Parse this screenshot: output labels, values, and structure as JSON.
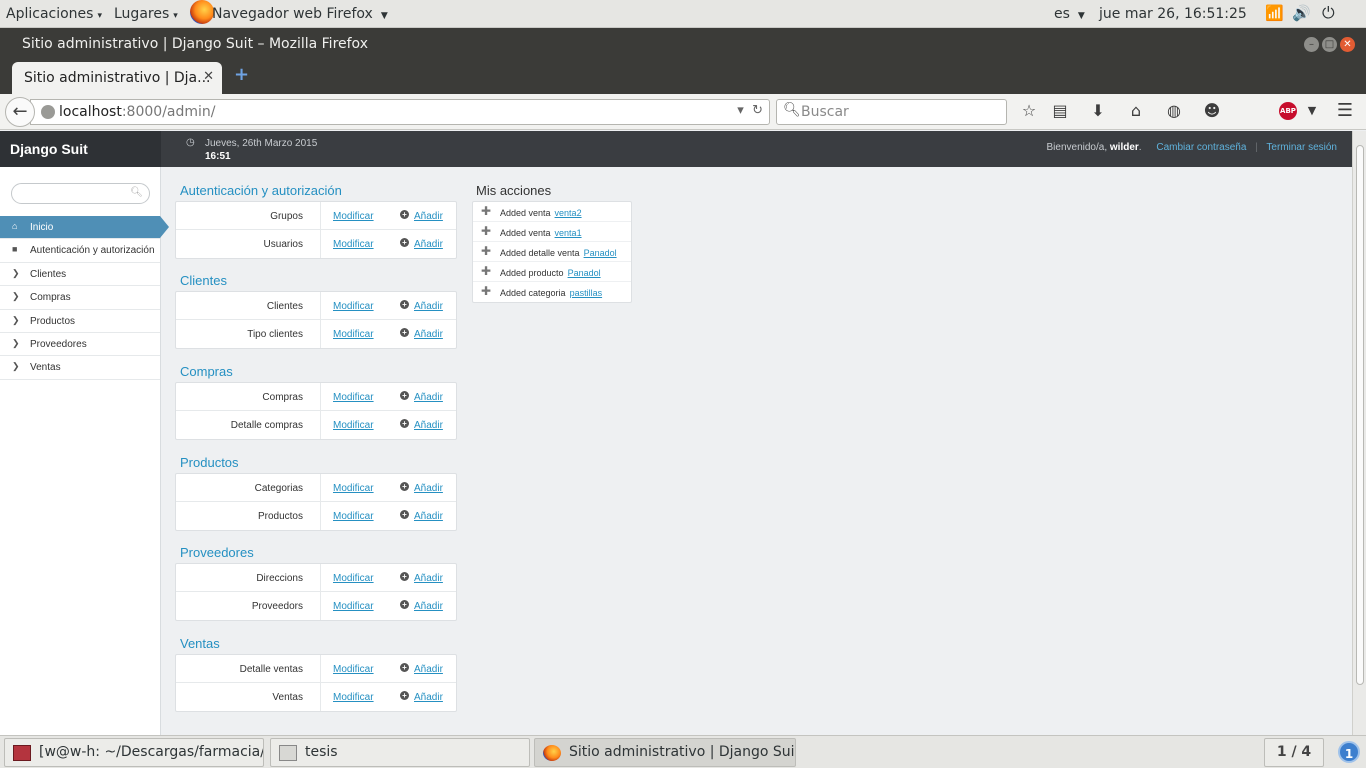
{
  "gnome_panel": {
    "apps_menu": "Aplicaciones",
    "places_menu": "Lugares",
    "active_app": "Navegador web Firefox",
    "language": "es",
    "clock": "jue mar 26, 16:51:25"
  },
  "window": {
    "title": "Sitio administrativo | Django Suit – Mozilla Firefox"
  },
  "browser": {
    "tab_title": "Sitio administrativo | Dja...",
    "tab_close": "✕",
    "new_tab": "+",
    "url_host": "localhost",
    "url_rest": ":8000/admin/",
    "search_placeholder": "Buscar",
    "abp_label": "ABP"
  },
  "suit": {
    "brand": "Django Suit",
    "date": "Jueves, 26th Marzo 2015",
    "time": "16:51",
    "welcome": "Bienvenido/a,",
    "username": "wilder",
    "change_password": "Cambiar contraseña",
    "separator": "|",
    "logout": "Terminar sesión"
  },
  "sidebar": {
    "search_placeholder": "",
    "items": [
      {
        "label": "Inicio",
        "icon": "home-icon"
      },
      {
        "label": "Autenticación y autorización",
        "icon": "lock-icon"
      },
      {
        "label": "Clientes",
        "icon": "chevron-right-icon"
      },
      {
        "label": "Compras",
        "icon": "chevron-right-icon"
      },
      {
        "label": "Productos",
        "icon": "chevron-right-icon"
      },
      {
        "label": "Proveedores",
        "icon": "chevron-right-icon"
      },
      {
        "label": "Ventas",
        "icon": "chevron-right-icon"
      }
    ]
  },
  "modules": [
    {
      "title": "Autenticación y autorización",
      "models": [
        {
          "name": "Grupos",
          "change": "Modificar",
          "add": "Añadir"
        },
        {
          "name": "Usuarios",
          "change": "Modificar",
          "add": "Añadir"
        }
      ]
    },
    {
      "title": "Clientes",
      "models": [
        {
          "name": "Clientes",
          "change": "Modificar",
          "add": "Añadir"
        },
        {
          "name": "Tipo clientes",
          "change": "Modificar",
          "add": "Añadir"
        }
      ]
    },
    {
      "title": "Compras",
      "models": [
        {
          "name": "Compras",
          "change": "Modificar",
          "add": "Añadir"
        },
        {
          "name": "Detalle compras",
          "change": "Modificar",
          "add": "Añadir"
        }
      ]
    },
    {
      "title": "Productos",
      "models": [
        {
          "name": "Categorias",
          "change": "Modificar",
          "add": "Añadir"
        },
        {
          "name": "Productos",
          "change": "Modificar",
          "add": "Añadir"
        }
      ]
    },
    {
      "title": "Proveedores",
      "models": [
        {
          "name": "Direccions",
          "change": "Modificar",
          "add": "Añadir"
        },
        {
          "name": "Proveedors",
          "change": "Modificar",
          "add": "Añadir"
        }
      ]
    },
    {
      "title": "Ventas",
      "models": [
        {
          "name": "Detalle ventas",
          "change": "Modificar",
          "add": "Añadir"
        },
        {
          "name": "Ventas",
          "change": "Modificar",
          "add": "Añadir"
        }
      ]
    }
  ],
  "actions": {
    "title": "Mis acciones",
    "items": [
      {
        "text": "Added venta",
        "object": "venta2"
      },
      {
        "text": "Added venta",
        "object": "venta1"
      },
      {
        "text": "Added detalle venta",
        "object": "Panadol"
      },
      {
        "text": "Added producto",
        "object": "Panadol"
      },
      {
        "text": "Added categoria",
        "object": "pastillas"
      }
    ]
  },
  "taskbar": {
    "tasks": [
      {
        "label": "[w@w-h: ~/Descargas/farmacia/fa..."
      },
      {
        "label": "tesis"
      },
      {
        "label": "Sitio administrativo | Django Suit ..."
      }
    ],
    "workspace": "1 / 4",
    "notifications": "1"
  },
  "colors": {
    "accent": "#2590c2",
    "sidebar_active": "#4f8fb6",
    "header_bg": "#3a3d41"
  }
}
